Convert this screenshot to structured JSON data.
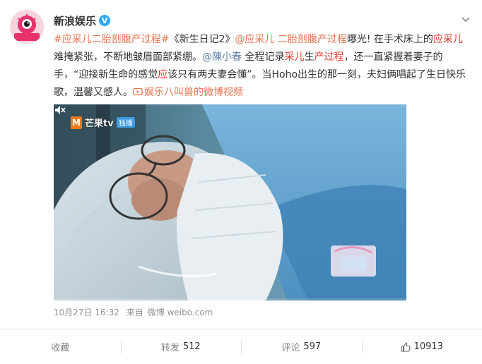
{
  "author": {
    "name": "新浪娱乐",
    "verified_badge": "V",
    "avatar_text": "新浪娱乐"
  },
  "post": {
    "line1": {
      "tag1": "#应采儿二胎剖腹产过程#",
      "text1": "《新生日记2》",
      "mention1": "@应采儿",
      "tag2": " 二胎剖腹产过程",
      "text2": "曝光! 在手术床上的",
      "hl1": "应采儿"
    },
    "line2": {
      "text1": "难掩紧张，不断地皱眉面部紧绷。",
      "mention2": "@陳小春",
      "text2": " 全程记录",
      "hl2": "采儿",
      "text3": "生",
      "hl3": "产过程",
      "text4": "，还一直紧握着妻子的"
    },
    "line3": {
      "text1": "手，“迎接新生命的感觉",
      "hl4": "应",
      "text2": "该只有两夫妻会懂”。当Hoho出生的那一刻，夫妇俩唱起了生日快乐"
    },
    "line4": {
      "text1": "歌，温馨又感人。",
      "video_link_icon": "video-link-icon",
      "video_link": "娱乐八叫兽的微博视频"
    }
  },
  "video": {
    "watermark_brand": "芒果tv",
    "watermark_tag": "独播",
    "mute_icon": "mute-icon",
    "progress": 0.0
  },
  "meta": {
    "date": "10月27日 16:32",
    "from_label": "来自",
    "source": "微博 weibo.com"
  },
  "actions": {
    "collect_label": "收藏",
    "repost_label": "转发",
    "repost_count": "512",
    "comment_label": "评论",
    "comment_count": "597",
    "like_icon": "thumbs-up-icon",
    "like_count": "10913"
  },
  "colors": {
    "link": "#eb7350",
    "mention": "#5a7ca8",
    "highlight": "#e0392b",
    "verified": "#2fa8f3"
  }
}
